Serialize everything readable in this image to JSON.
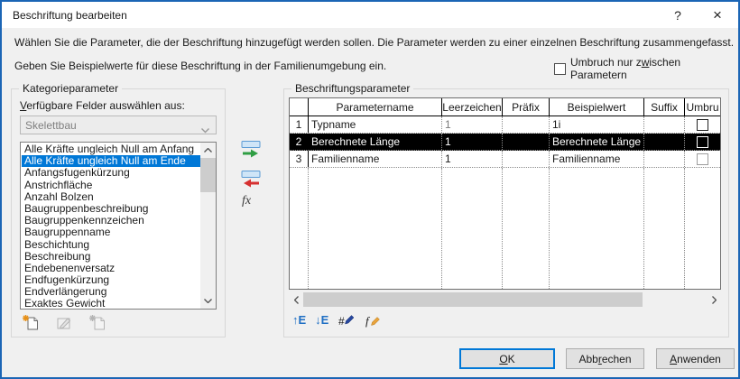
{
  "window": {
    "title": "Beschriftung bearbeiten",
    "help_glyph": "?",
    "close_glyph": "×"
  },
  "intro": {
    "line1": "Wählen Sie die Parameter, die der Beschriftung hinzugefügt werden sollen. Die Parameter werden zu einer einzelnen Beschriftung zusammengefasst.",
    "line2": "Geben Sie Beispielwerte für diese Beschriftung in der Familienumgebung ein."
  },
  "wrap_option": {
    "pre": "Umbruch nur z",
    "accel": "w",
    "post": "ischen Parametern",
    "checked": false
  },
  "category_panel": {
    "title": "Kategorieparameter",
    "fields_label": {
      "pre": "",
      "accel": "V",
      "post": "erfügbare Felder auswählen aus:"
    },
    "source_select": {
      "value": "Skelettbau",
      "disabled": true
    },
    "parameters": [
      "Alle Kräfte ungleich Null am Anfang",
      "Alle Kräfte ungleich Null am Ende",
      "Anfangsfugenkürzung",
      "Anstrichfläche",
      "Anzahl Bolzen",
      "Baugruppenbeschreibung",
      "Baugruppenkennzeichen",
      "Baugruppenname",
      "Beschichtung",
      "Beschreibung",
      "Endebenenversatz",
      "Endfugenkürzung",
      "Endverlängerung",
      "Exaktes Gewicht"
    ],
    "selected_index": 1,
    "selected_parameter": "Alle Kräfte ungleich Null am Ende"
  },
  "label_panel": {
    "title": "Beschriftungsparameter",
    "columns": {
      "name": "Parametername",
      "spaces": "Leerzeichen",
      "prefix": "Präfix",
      "sample": "Beispielwert",
      "suffix": "Suffix",
      "break": "Umbru"
    },
    "rows": [
      {
        "num": "1",
        "name": "Typname",
        "spaces": "1",
        "prefix": "",
        "sample": "1i",
        "suffix": "",
        "break_checked": false
      },
      {
        "num": "2",
        "name": "Berechnete Länge",
        "spaces": "1",
        "prefix": "",
        "sample": "Berechnete Länge",
        "suffix": "",
        "break_checked": false
      },
      {
        "num": "3",
        "name": "Familienname",
        "spaces": "1",
        "prefix": "",
        "sample": "Familienname",
        "suffix": "",
        "break_checked": false
      }
    ],
    "selected_row_index": 1
  },
  "icons": {
    "add_to_label": "add-parameter-icon",
    "remove_from_label": "remove-parameter-icon",
    "fx": "fx",
    "new_parameter": "new-parameter-icon",
    "edit_parameter": "edit-parameter-icon",
    "delete_parameter": "delete-parameter-icon",
    "move_up_glyph": "↑",
    "move_down_glyph": "↓",
    "move_letter": "E",
    "edit_units_glyph": "#",
    "edit_formula_glyph": "f"
  },
  "buttons": {
    "ok": {
      "pre": "",
      "accel": "O",
      "post": "K"
    },
    "cancel": {
      "pre": "Abb",
      "accel": "r",
      "post": "echen"
    },
    "apply": {
      "pre": "",
      "accel": "A",
      "post": "nwenden"
    }
  },
  "colors": {
    "accent_border": "#1b65b5",
    "list_selection": "#0078d7",
    "row_selection": "#000000",
    "ok_focus_border": "#0078d7",
    "body_bg": "#f0f0f0"
  }
}
